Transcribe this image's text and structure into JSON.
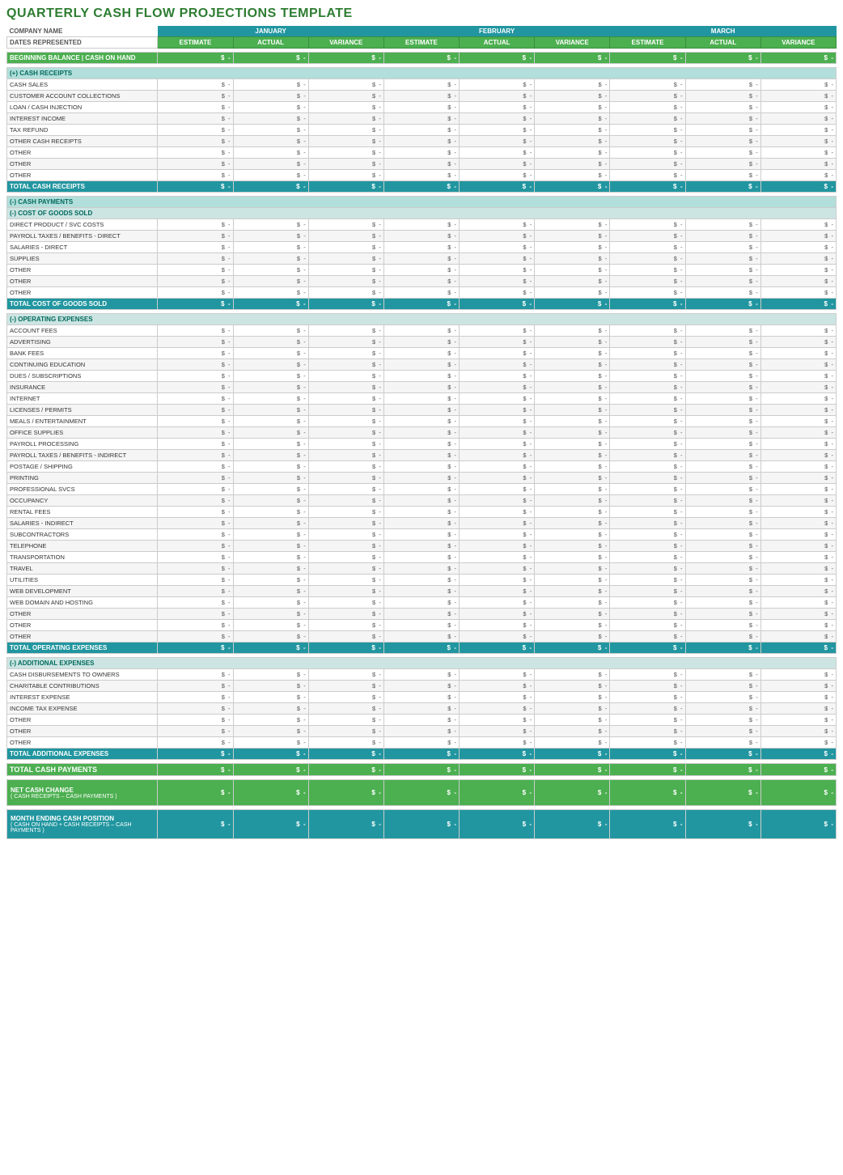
{
  "title": "QUARTERLY CASH FLOW PROJECTIONS TEMPLATE",
  "header": {
    "company_name_label": "COMPANY NAME",
    "dates_label": "DATES REPRESENTED",
    "months": [
      "JANUARY",
      "FEBRUARY",
      "MARCH"
    ],
    "col_headers": [
      "ESTIMATE",
      "ACTUAL",
      "VARIANCE"
    ]
  },
  "beginning_balance": {
    "label": "BEGINNING BALANCE | CASH ON HAND",
    "values": [
      "-",
      "-",
      "-",
      "-",
      "-",
      "-",
      "-",
      "-",
      "-"
    ]
  },
  "cash_receipts": {
    "section_label": "(+) CASH RECEIPTS",
    "items": [
      "CASH SALES",
      "CUSTOMER ACCOUNT COLLECTIONS",
      "LOAN / CASH INJECTION",
      "INTEREST INCOME",
      "TAX REFUND",
      "OTHER CASH RECEIPTS",
      "OTHER",
      "OTHER",
      "OTHER"
    ],
    "total_label": "TOTAL CASH RECEIPTS"
  },
  "cash_payments": {
    "section_label": "(-) CASH PAYMENTS",
    "cost_of_goods": {
      "section_label": "(-) COST OF GOODS SOLD",
      "items": [
        "DIRECT PRODUCT / SVC COSTS",
        "PAYROLL TAXES / BENEFITS - DIRECT",
        "SALARIES - DIRECT",
        "SUPPLIES",
        "OTHER",
        "OTHER",
        "OTHER"
      ],
      "total_label": "TOTAL COST OF GOODS SOLD"
    },
    "operating_expenses": {
      "section_label": "(-) OPERATING EXPENSES",
      "items": [
        "ACCOUNT FEES",
        "ADVERTISING",
        "BANK FEES",
        "CONTINUING EDUCATION",
        "DUES / SUBSCRIPTIONS",
        "INSURANCE",
        "INTERNET",
        "LICENSES / PERMITS",
        "MEALS / ENTERTAINMENT",
        "OFFICE SUPPLIES",
        "PAYROLL PROCESSING",
        "PAYROLL TAXES / BENEFITS - INDIRECT",
        "POSTAGE / SHIPPING",
        "PRINTING",
        "PROFESSIONAL SVCS",
        "OCCUPANCY",
        "RENTAL FEES",
        "SALARIES - INDIRECT",
        "SUBCONTRACTORS",
        "TELEPHONE",
        "TRANSPORTATION",
        "TRAVEL",
        "UTILITIES",
        "WEB DEVELOPMENT",
        "WEB DOMAIN AND HOSTING",
        "OTHER",
        "OTHER",
        "OTHER"
      ],
      "total_label": "TOTAL OPERATING EXPENSES"
    },
    "additional_expenses": {
      "section_label": "(-) ADDITIONAL EXPENSES",
      "items": [
        "CASH DISBURSEMENTS TO OWNERS",
        "CHARITABLE CONTRIBUTIONS",
        "INTEREST EXPENSE",
        "INCOME TAX EXPENSE",
        "OTHER",
        "OTHER",
        "OTHER"
      ],
      "total_label": "TOTAL ADDITIONAL EXPENSES"
    },
    "total_label": "TOTAL CASH PAYMENTS"
  },
  "net_cash_change": {
    "label": "NET CASH CHANGE",
    "sublabel": "( CASH RECEIPTS – CASH PAYMENTS )"
  },
  "month_ending": {
    "label": "MONTH ENDING CASH POSITION",
    "sublabel": "( CASH ON HAND + CASH RECEIPTS – CASH PAYMENTS )"
  },
  "dash": "-"
}
